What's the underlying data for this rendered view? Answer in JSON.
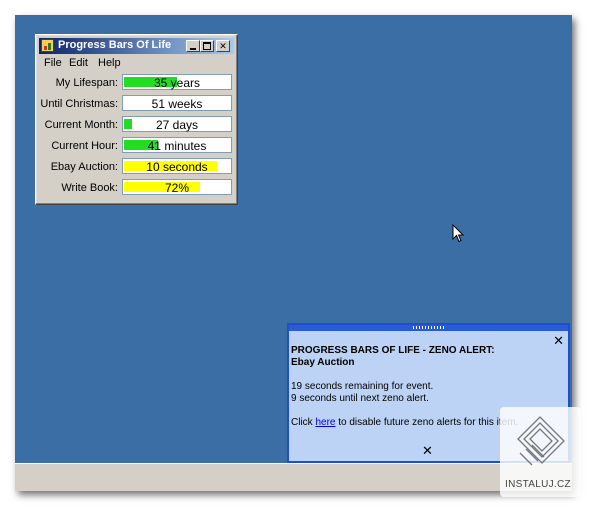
{
  "window": {
    "title": "Progress Bars Of Life",
    "min_symbol": "",
    "max_symbol": "",
    "close_symbol": "✕"
  },
  "menu": [
    "File",
    "Edit",
    "Help"
  ],
  "bars": [
    {
      "label": "My Lifespan:",
      "value_text": "35 years",
      "fill_fraction": 0.5,
      "fill_color": "#22dd22"
    },
    {
      "label": "Until Christmas:",
      "value_text": "51 weeks",
      "fill_fraction": 0.0,
      "fill_color": "#22dd22"
    },
    {
      "label": "Current Month:",
      "value_text": "27 days",
      "fill_fraction": 0.08,
      "fill_color": "#22dd22"
    },
    {
      "label": "Current Hour:",
      "value_text": "41 minutes",
      "fill_fraction": 0.32,
      "fill_color": "#22dd22"
    },
    {
      "label": "Ebay Auction:",
      "value_text": "10 seconds",
      "fill_fraction": 0.88,
      "fill_color": "#ffff00"
    },
    {
      "label": "Write Book:",
      "value_text": "72%",
      "fill_fraction": 0.72,
      "fill_color": "#ffff00"
    }
  ],
  "alert": {
    "heading": "PROGRESS BARS OF LIFE - ZENO ALERT:",
    "subheading": "Ebay Auction",
    "line1": "19 seconds remaining for event.",
    "line2": "9 seconds until next zeno alert.",
    "click_prefix": "Click",
    "link_text": "here",
    "click_suffix": "to disable future zeno alerts for this item.",
    "close_symbol": "✕",
    "bottom_close_symbol": "✕"
  },
  "watermark": {
    "text": "INSTALUJ.CZ"
  },
  "colors": {
    "desktop": "#3b6ea5",
    "taskbar": "#d4d0c8",
    "title_start": "#0a246a",
    "title_end": "#a6caf0",
    "alert_bg": "#bcd3f5"
  }
}
